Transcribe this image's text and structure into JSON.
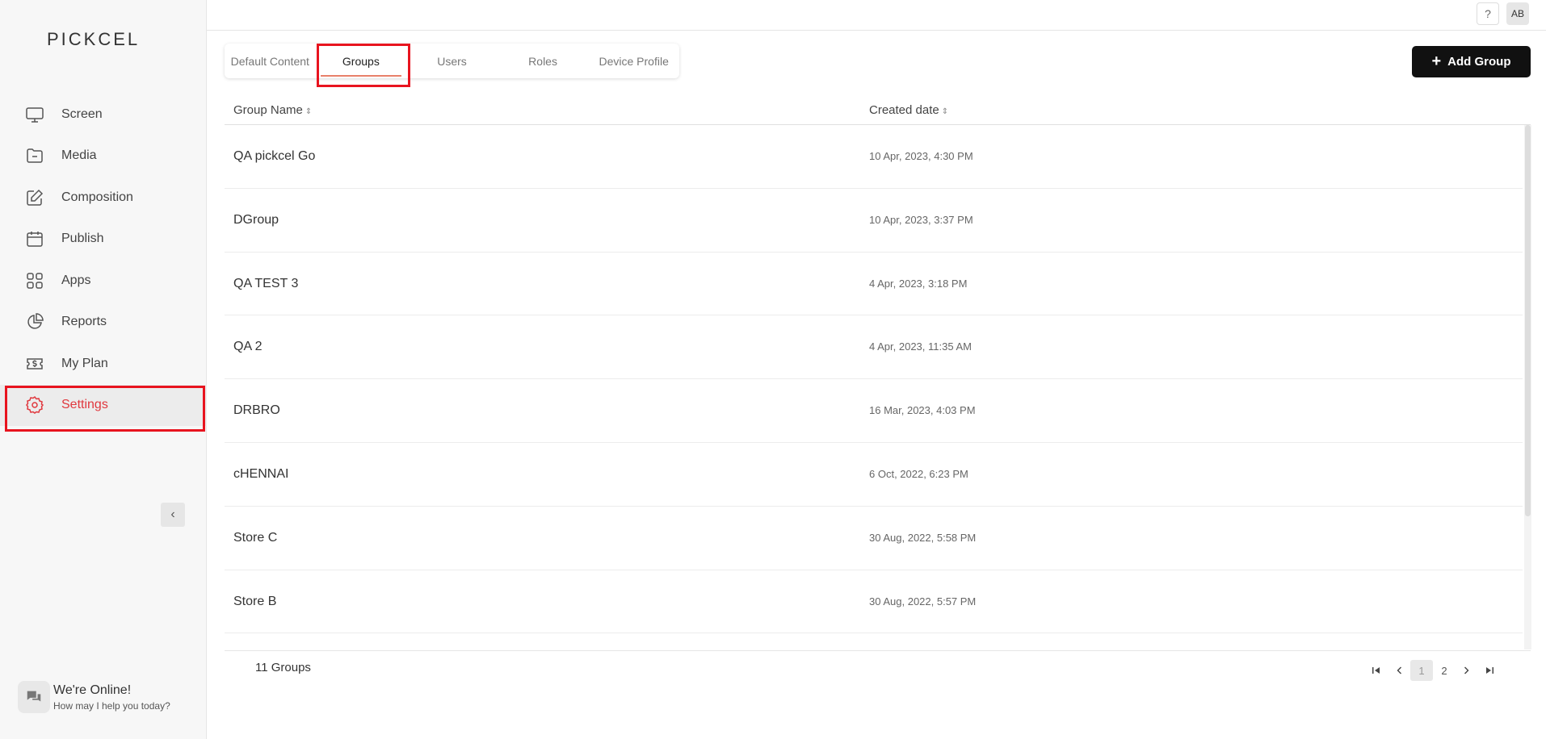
{
  "app": {
    "logo": "PICKCEL"
  },
  "sidebar": {
    "items": [
      {
        "label": "Screen",
        "icon": "monitor-icon"
      },
      {
        "label": "Media",
        "icon": "folder-icon"
      },
      {
        "label": "Composition",
        "icon": "edit-icon"
      },
      {
        "label": "Publish",
        "icon": "calendar-icon"
      },
      {
        "label": "Apps",
        "icon": "apps-grid-icon"
      },
      {
        "label": "Reports",
        "icon": "pie-chart-icon"
      },
      {
        "label": "My Plan",
        "icon": "ticket-dollar-icon"
      },
      {
        "label": "Settings",
        "icon": "gear-icon",
        "active": true
      }
    ],
    "collapse_glyph": "‹",
    "chat": {
      "title": "We're Online!",
      "subtitle": "How may I help you today?"
    }
  },
  "topbar": {
    "help": "?",
    "avatar": "AB"
  },
  "tabs": [
    {
      "label": "Default Content"
    },
    {
      "label": "Groups",
      "active": true
    },
    {
      "label": "Users"
    },
    {
      "label": "Roles"
    },
    {
      "label": "Device Profile"
    }
  ],
  "actions": {
    "add_group_label": "Add Group",
    "add_icon": "+"
  },
  "table": {
    "columns": [
      {
        "label": "Group Name"
      },
      {
        "label": "Created date"
      }
    ],
    "sort_glyph": "⇕",
    "rows": [
      {
        "name": "QA pickcel Go",
        "date": "10 Apr, 2023, 4:30 PM"
      },
      {
        "name": "DGroup",
        "date": "10 Apr, 2023, 3:37 PM"
      },
      {
        "name": "QA TEST 3",
        "date": "4 Apr, 2023, 3:18 PM"
      },
      {
        "name": "QA 2",
        "date": "4 Apr, 2023, 11:35 AM"
      },
      {
        "name": "DRBRO",
        "date": "16 Mar, 2023, 4:03 PM"
      },
      {
        "name": "cHENNAI",
        "date": "6 Oct, 2022, 6:23 PM"
      },
      {
        "name": "Store C",
        "date": "30 Aug, 2022, 5:58 PM"
      },
      {
        "name": "Store B",
        "date": "30 Aug, 2022, 5:57 PM"
      }
    ]
  },
  "footer": {
    "count_label": "11 Groups",
    "pages": [
      "1",
      "2"
    ],
    "current_page": "1"
  },
  "colors": {
    "accent": "#e0383e",
    "highlight": "#e8141f",
    "button": "#111111"
  }
}
